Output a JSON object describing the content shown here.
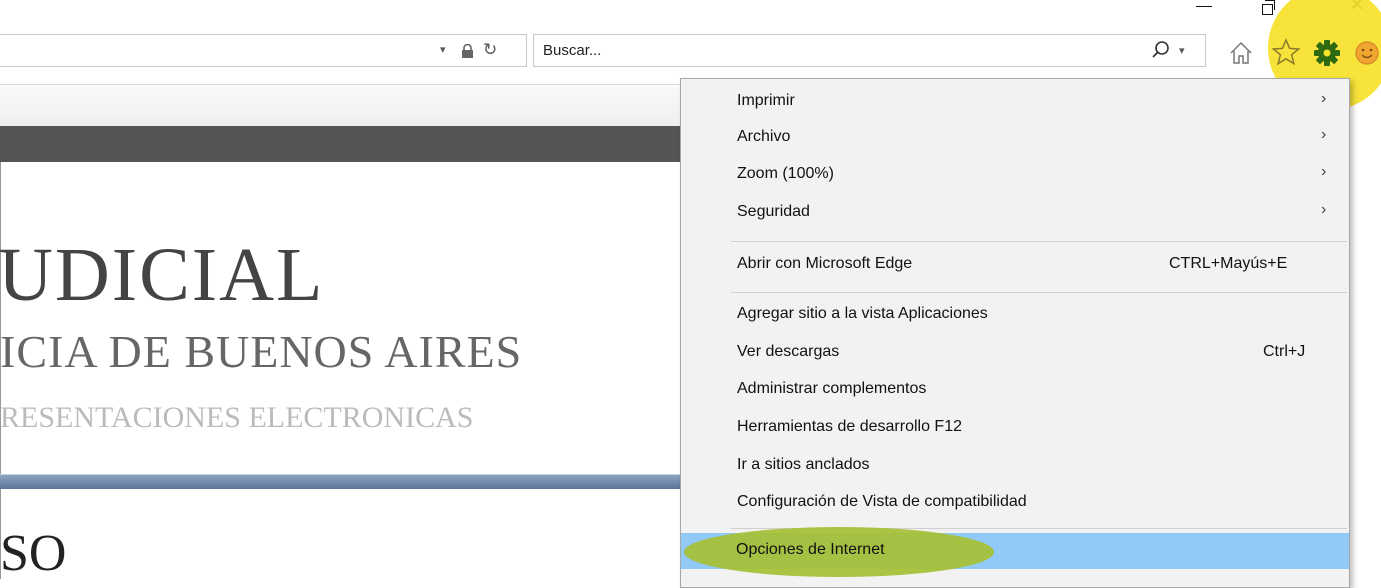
{
  "window": {
    "minimize_icon": "minimize-icon",
    "maximize_icon": "restore-icon",
    "close_glyph": "✕"
  },
  "address_bar": {
    "dropdown_glyph": "▾",
    "refresh_glyph": "↻"
  },
  "search": {
    "placeholder": "Buscar...",
    "dropdown_glyph": "▾"
  },
  "toolbar": {
    "icons": [
      "home-icon",
      "favorites-star-icon",
      "tools-gear-icon",
      "smiley-feedback-icon"
    ],
    "highlight_color": "#f6e12a"
  },
  "page": {
    "heading_1": "UDICIAL",
    "heading_2": "ICIA DE BUENOS AIRES",
    "heading_3": "RESENTACIONES ELECTRONICAS",
    "heading_4": "SO"
  },
  "menu": {
    "items": [
      {
        "label": "Imprimir",
        "arrow": "›"
      },
      {
        "label": "Archivo",
        "arrow": "›"
      },
      {
        "label": "Zoom (100%)",
        "arrow": "›"
      },
      {
        "label": "Seguridad",
        "arrow": "›"
      },
      {
        "label": "Abrir con Microsoft Edge",
        "shortcut": "CTRL+Mayús+E"
      },
      {
        "label": "Agregar sitio a la vista Aplicaciones"
      },
      {
        "label": "Ver descargas",
        "shortcut": "Ctrl+J"
      },
      {
        "label": "Administrar complementos"
      },
      {
        "label": "Herramientas de desarrollo F12"
      },
      {
        "label": "Ir a sitios anclados"
      },
      {
        "label": "Configuración de Vista de compatibilidad"
      },
      {
        "label": "Opciones de Internet"
      }
    ],
    "selected_item_color": "#91c9f7",
    "annotation_color": "#a7c13a"
  }
}
